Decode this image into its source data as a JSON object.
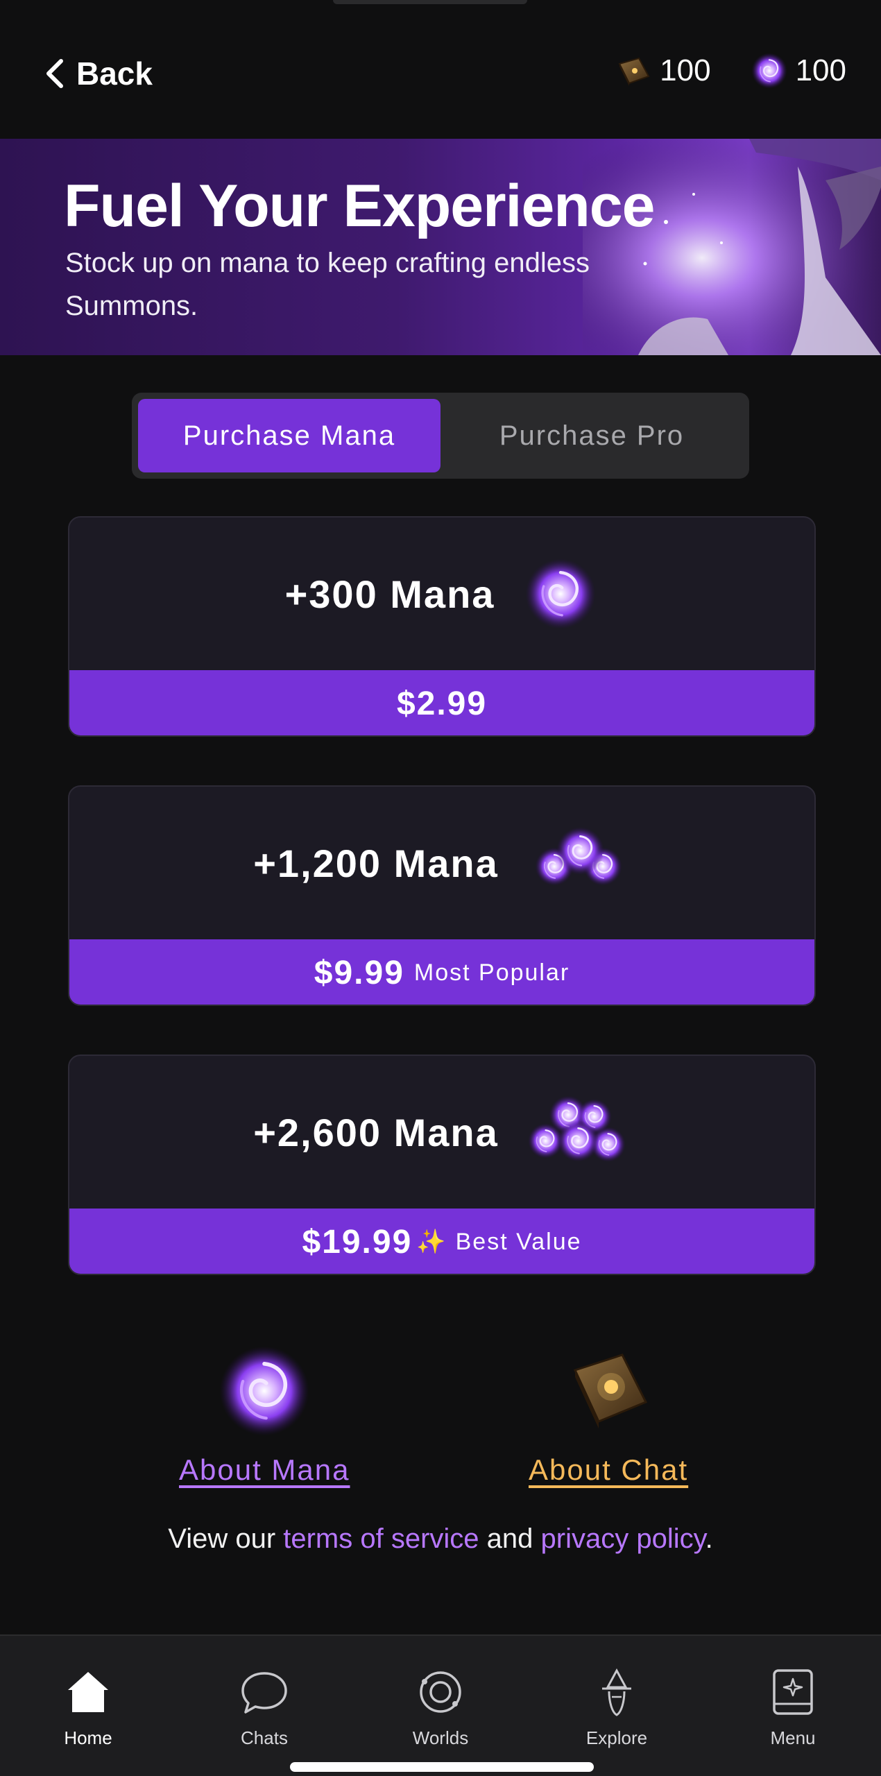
{
  "header": {
    "back_label": "Back",
    "chat_count": "100",
    "mana_count": "100",
    "icons": {
      "back": "chevron-left-icon",
      "chat": "book-icon",
      "mana": "mana-orb-icon"
    }
  },
  "banner": {
    "title": "Fuel Your Experience",
    "subtitle": "Stock up on mana to keep crafting endless Summons."
  },
  "tabs": [
    {
      "label": "Purchase Mana",
      "active": true
    },
    {
      "label": "Purchase Pro",
      "active": false
    }
  ],
  "packages": [
    {
      "amount": "+300 Mana",
      "price": "$2.99",
      "tag": ""
    },
    {
      "amount": "+1,200 Mana",
      "price": "$9.99",
      "tag": "Most Popular"
    },
    {
      "amount": "+2,600 Mana",
      "price": "$19.99",
      "tag": "Best Value"
    }
  ],
  "about": {
    "mana_label": "About Mana",
    "chat_label": "About Chat"
  },
  "legal": {
    "prefix": "View our ",
    "terms": "terms of service",
    "middle": " and ",
    "privacy": "privacy policy",
    "suffix": "."
  },
  "nav": [
    {
      "label": "Home",
      "icon": "home-icon"
    },
    {
      "label": "Chats",
      "icon": "chat-bubble-icon"
    },
    {
      "label": "Worlds",
      "icon": "planet-icon"
    },
    {
      "label": "Explore",
      "icon": "wizard-icon"
    },
    {
      "label": "Menu",
      "icon": "menu-book-icon"
    }
  ],
  "colors": {
    "background": "#0f0f10",
    "accent": "#7632d8",
    "card": "#1c1a24",
    "link_purple": "#b878ff",
    "link_gold": "#f5b95a"
  }
}
